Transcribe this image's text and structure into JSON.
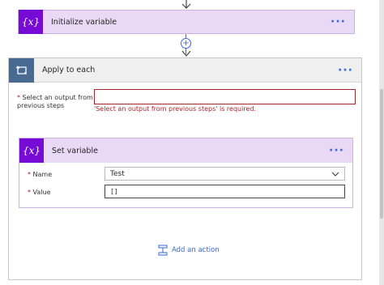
{
  "init_variable": {
    "icon_text": "{x}",
    "title": "Initialize variable",
    "menu": "···"
  },
  "connector": {
    "plus": "+"
  },
  "apply_to_each": {
    "title": "Apply to each",
    "menu": "···",
    "select_label_req": "*",
    "select_label": " Select an output from previous steps",
    "select_value": "",
    "error": "'Select an output from previous steps' is required."
  },
  "set_variable": {
    "icon_text": "{x}",
    "title": "Set variable",
    "menu": "···",
    "name_req": "*",
    "name_label": " Name",
    "name_value": "Test",
    "value_req": "*",
    "value_label": " Value",
    "value_value": "[]"
  },
  "add_action": {
    "label": "Add an action"
  },
  "colors": {
    "variable_accent": "#770bd6",
    "variable_header": "#e9d9f6",
    "loop_accent": "#486991",
    "error": "#a4262c",
    "link": "#3a66d9"
  }
}
